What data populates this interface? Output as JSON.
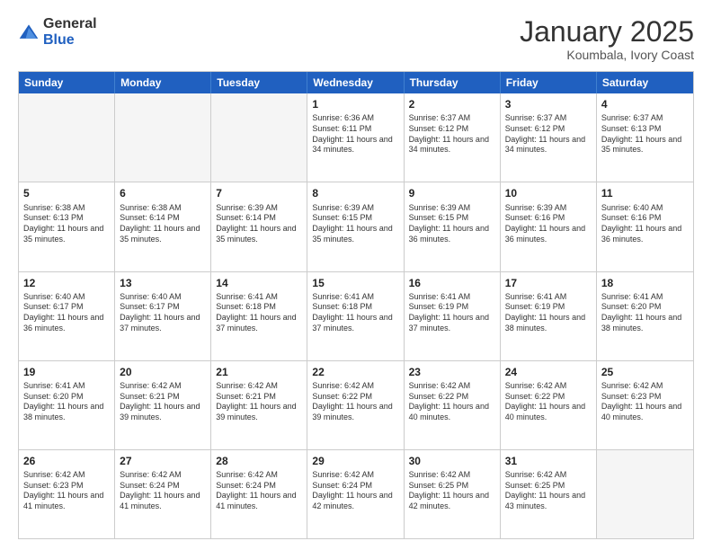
{
  "header": {
    "logo_general": "General",
    "logo_blue": "Blue",
    "title": "January 2025",
    "location": "Koumbala, Ivory Coast"
  },
  "days_of_week": [
    "Sunday",
    "Monday",
    "Tuesday",
    "Wednesday",
    "Thursday",
    "Friday",
    "Saturday"
  ],
  "weeks": [
    [
      {
        "day": "",
        "info": ""
      },
      {
        "day": "",
        "info": ""
      },
      {
        "day": "",
        "info": ""
      },
      {
        "day": "1",
        "info": "Sunrise: 6:36 AM\nSunset: 6:11 PM\nDaylight: 11 hours\nand 34 minutes."
      },
      {
        "day": "2",
        "info": "Sunrise: 6:37 AM\nSunset: 6:12 PM\nDaylight: 11 hours\nand 34 minutes."
      },
      {
        "day": "3",
        "info": "Sunrise: 6:37 AM\nSunset: 6:12 PM\nDaylight: 11 hours\nand 34 minutes."
      },
      {
        "day": "4",
        "info": "Sunrise: 6:37 AM\nSunset: 6:13 PM\nDaylight: 11 hours\nand 35 minutes."
      }
    ],
    [
      {
        "day": "5",
        "info": "Sunrise: 6:38 AM\nSunset: 6:13 PM\nDaylight: 11 hours\nand 35 minutes."
      },
      {
        "day": "6",
        "info": "Sunrise: 6:38 AM\nSunset: 6:14 PM\nDaylight: 11 hours\nand 35 minutes."
      },
      {
        "day": "7",
        "info": "Sunrise: 6:39 AM\nSunset: 6:14 PM\nDaylight: 11 hours\nand 35 minutes."
      },
      {
        "day": "8",
        "info": "Sunrise: 6:39 AM\nSunset: 6:15 PM\nDaylight: 11 hours\nand 35 minutes."
      },
      {
        "day": "9",
        "info": "Sunrise: 6:39 AM\nSunset: 6:15 PM\nDaylight: 11 hours\nand 36 minutes."
      },
      {
        "day": "10",
        "info": "Sunrise: 6:39 AM\nSunset: 6:16 PM\nDaylight: 11 hours\nand 36 minutes."
      },
      {
        "day": "11",
        "info": "Sunrise: 6:40 AM\nSunset: 6:16 PM\nDaylight: 11 hours\nand 36 minutes."
      }
    ],
    [
      {
        "day": "12",
        "info": "Sunrise: 6:40 AM\nSunset: 6:17 PM\nDaylight: 11 hours\nand 36 minutes."
      },
      {
        "day": "13",
        "info": "Sunrise: 6:40 AM\nSunset: 6:17 PM\nDaylight: 11 hours\nand 37 minutes."
      },
      {
        "day": "14",
        "info": "Sunrise: 6:41 AM\nSunset: 6:18 PM\nDaylight: 11 hours\nand 37 minutes."
      },
      {
        "day": "15",
        "info": "Sunrise: 6:41 AM\nSunset: 6:18 PM\nDaylight: 11 hours\nand 37 minutes."
      },
      {
        "day": "16",
        "info": "Sunrise: 6:41 AM\nSunset: 6:19 PM\nDaylight: 11 hours\nand 37 minutes."
      },
      {
        "day": "17",
        "info": "Sunrise: 6:41 AM\nSunset: 6:19 PM\nDaylight: 11 hours\nand 38 minutes."
      },
      {
        "day": "18",
        "info": "Sunrise: 6:41 AM\nSunset: 6:20 PM\nDaylight: 11 hours\nand 38 minutes."
      }
    ],
    [
      {
        "day": "19",
        "info": "Sunrise: 6:41 AM\nSunset: 6:20 PM\nDaylight: 11 hours\nand 38 minutes."
      },
      {
        "day": "20",
        "info": "Sunrise: 6:42 AM\nSunset: 6:21 PM\nDaylight: 11 hours\nand 39 minutes."
      },
      {
        "day": "21",
        "info": "Sunrise: 6:42 AM\nSunset: 6:21 PM\nDaylight: 11 hours\nand 39 minutes."
      },
      {
        "day": "22",
        "info": "Sunrise: 6:42 AM\nSunset: 6:22 PM\nDaylight: 11 hours\nand 39 minutes."
      },
      {
        "day": "23",
        "info": "Sunrise: 6:42 AM\nSunset: 6:22 PM\nDaylight: 11 hours\nand 40 minutes."
      },
      {
        "day": "24",
        "info": "Sunrise: 6:42 AM\nSunset: 6:22 PM\nDaylight: 11 hours\nand 40 minutes."
      },
      {
        "day": "25",
        "info": "Sunrise: 6:42 AM\nSunset: 6:23 PM\nDaylight: 11 hours\nand 40 minutes."
      }
    ],
    [
      {
        "day": "26",
        "info": "Sunrise: 6:42 AM\nSunset: 6:23 PM\nDaylight: 11 hours\nand 41 minutes."
      },
      {
        "day": "27",
        "info": "Sunrise: 6:42 AM\nSunset: 6:24 PM\nDaylight: 11 hours\nand 41 minutes."
      },
      {
        "day": "28",
        "info": "Sunrise: 6:42 AM\nSunset: 6:24 PM\nDaylight: 11 hours\nand 41 minutes."
      },
      {
        "day": "29",
        "info": "Sunrise: 6:42 AM\nSunset: 6:24 PM\nDaylight: 11 hours\nand 42 minutes."
      },
      {
        "day": "30",
        "info": "Sunrise: 6:42 AM\nSunset: 6:25 PM\nDaylight: 11 hours\nand 42 minutes."
      },
      {
        "day": "31",
        "info": "Sunrise: 6:42 AM\nSunset: 6:25 PM\nDaylight: 11 hours\nand 43 minutes."
      },
      {
        "day": "",
        "info": ""
      }
    ]
  ]
}
